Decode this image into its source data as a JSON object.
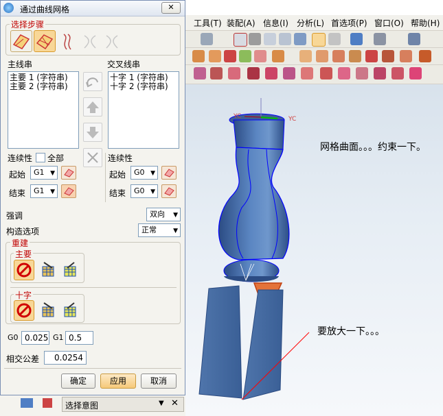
{
  "app": {
    "menus": [
      "工具(T)",
      "装配(A)",
      "信息(I)",
      "分析(L)",
      "首选项(P)",
      "窗口(O)",
      "帮助(H)"
    ]
  },
  "viewport": {
    "axis_labels": [
      "YC",
      "YC"
    ],
    "note_top": "网格曲面。。。约束一下。",
    "note_bottom": "要放大一下。。。",
    "colors": {
      "model": "#4a70a8",
      "edge": "#0000ff",
      "highlight": "#e0501a",
      "annotation_line": "#ff0000"
    }
  },
  "dialog": {
    "title": "通过曲线网格",
    "close_icon": "close-icon",
    "steps_label": "选择步骤",
    "primary_label": "主线串",
    "cross_label": "交叉线串",
    "primary_items": [
      "主要 1 (字符串)",
      "主要 2 (字符串)"
    ],
    "cross_items": [
      "十字 1 (字符串)",
      "十字 2 (字符串)"
    ],
    "continuity_label": "连续性",
    "all_label": "全部",
    "start_label": "起始",
    "end_label": "结束",
    "primary_start": "G1",
    "primary_end": "G1",
    "cross_start": "G0",
    "cross_end": "G0",
    "emphasis_label": "强调",
    "emphasis_value": "双向",
    "build_label": "构造选项",
    "build_value": "正常",
    "rebuild_label": "重建",
    "rebuild_primary": "主要",
    "rebuild_cross": "十字",
    "g0_label": "G0",
    "g0_value": "0.025",
    "g1_label": "G1",
    "g1_value": "0.5",
    "tolerance_label": "相交公差",
    "tolerance_value": "0.0254",
    "ok": "确定",
    "apply": "应用",
    "cancel": "取消"
  },
  "bottom": {
    "panel_title": "选择意图"
  }
}
